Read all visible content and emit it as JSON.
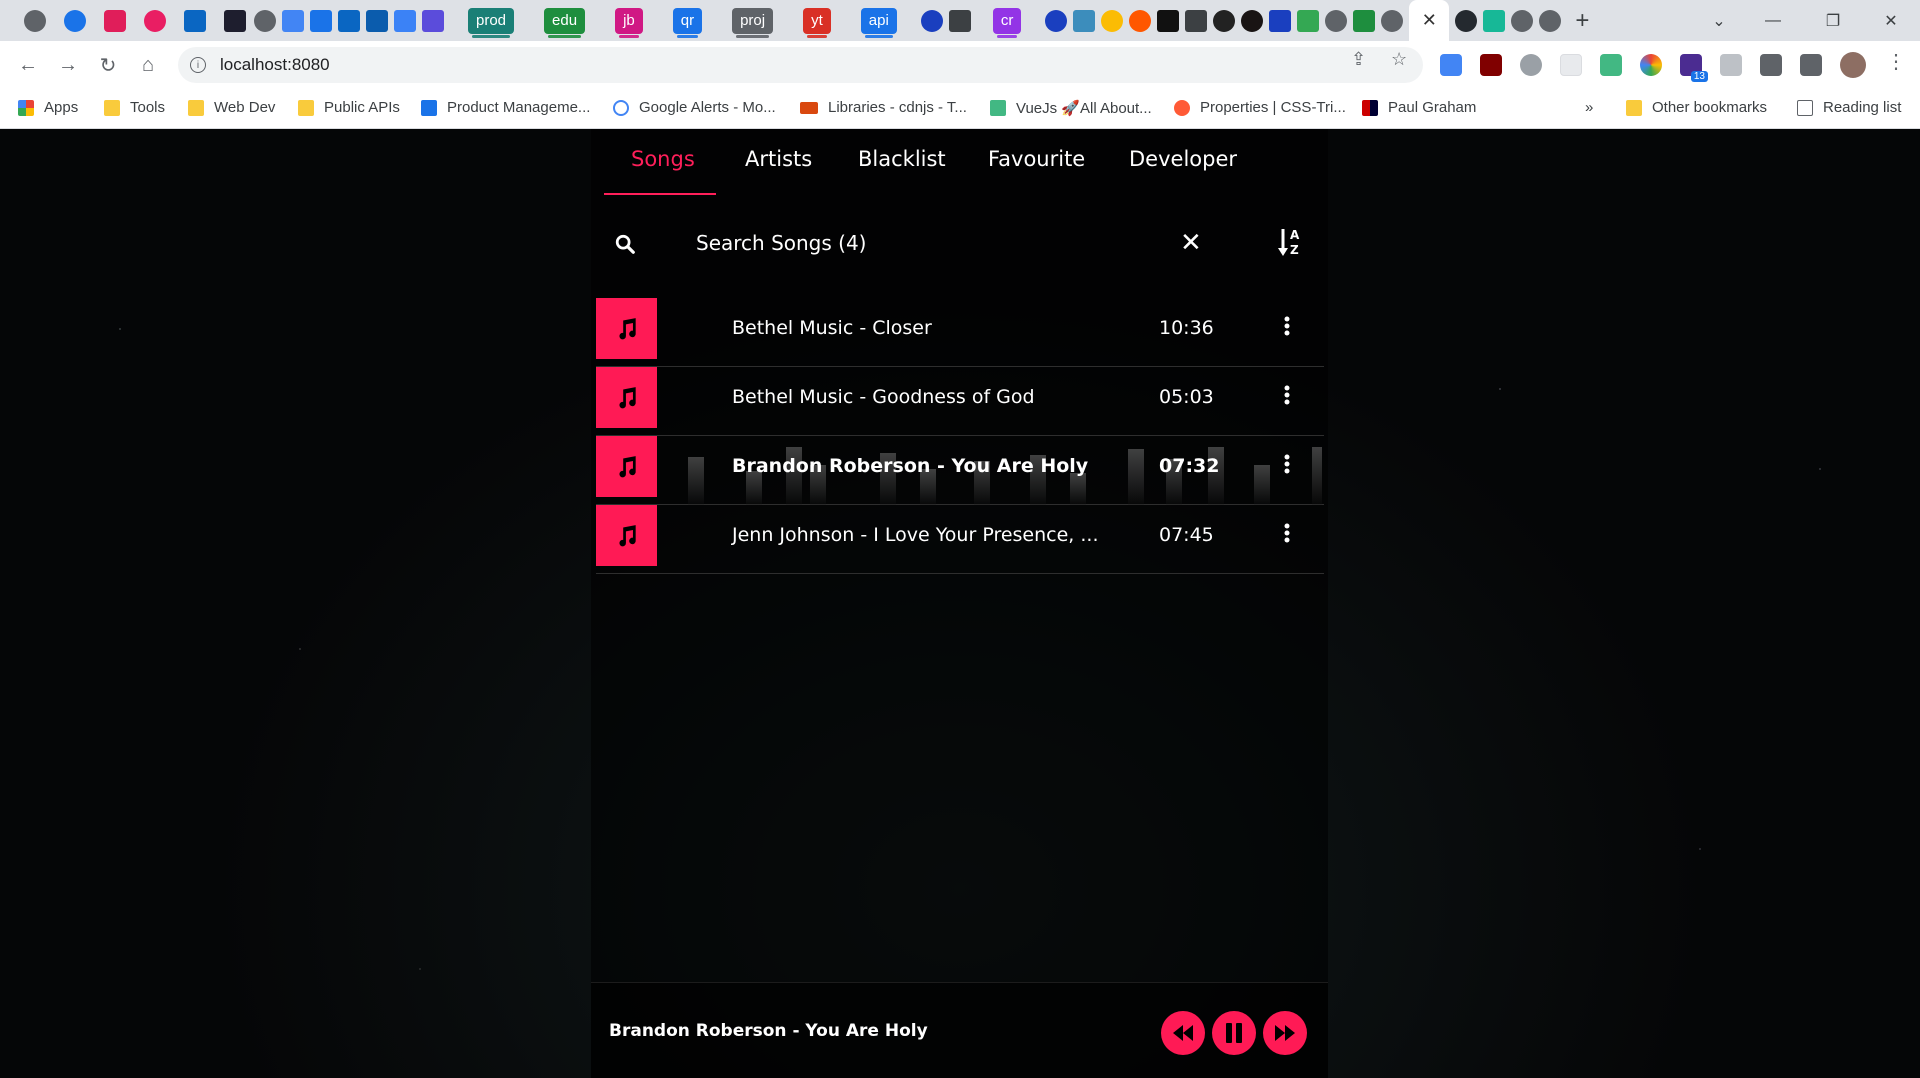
{
  "browser": {
    "url": "localhost:8080",
    "tab_groups": [
      {
        "label": "prod",
        "color": "#1a7f76"
      },
      {
        "label": "edu",
        "color": "#1e8e3e"
      },
      {
        "label": "jb",
        "color": "#d01884"
      },
      {
        "label": "qr",
        "color": "#1a73e8"
      },
      {
        "label": "proj",
        "color": "#5f6368"
      },
      {
        "label": "yt",
        "color": "#d93025"
      },
      {
        "label": "api",
        "color": "#1a73e8"
      },
      {
        "label": "cr",
        "color": "#9334e6"
      }
    ],
    "bookmarks": [
      {
        "label": "Apps"
      },
      {
        "label": "Tools"
      },
      {
        "label": "Web Dev"
      },
      {
        "label": "Public APIs"
      },
      {
        "label": "Product Manageme..."
      },
      {
        "label": "Google Alerts - Mo..."
      },
      {
        "label": "Libraries - cdnjs - T..."
      },
      {
        "label": "VueJs 🚀All About..."
      },
      {
        "label": "Properties | CSS-Tri..."
      },
      {
        "label": "Paul Graham"
      },
      {
        "label": "Other bookmarks"
      },
      {
        "label": "Reading list"
      }
    ],
    "extension_badge": "13"
  },
  "app": {
    "tabs": [
      {
        "label": "Songs",
        "active": true
      },
      {
        "label": "Artists",
        "active": false
      },
      {
        "label": "Blacklist",
        "active": false
      },
      {
        "label": "Favourite",
        "active": false
      },
      {
        "label": "Developer",
        "active": false
      }
    ],
    "search": {
      "placeholder": "Search Songs (4)",
      "value": ""
    },
    "songs": [
      {
        "title": "Bethel Music - Closer",
        "duration": "10:36",
        "playing": false
      },
      {
        "title": "Bethel Music - Goodness of God",
        "duration": "05:03",
        "playing": false
      },
      {
        "title": "Brandon Roberson - You Are Holy",
        "duration": "07:32",
        "playing": true
      },
      {
        "title": "Jenn Johnson - I Love Your Presence, ...",
        "duration": "07:45",
        "playing": false
      }
    ],
    "player": {
      "now_playing": "Brandon Roberson - You Are Holy"
    },
    "colors": {
      "accent": "#ff1a55",
      "background": "#000000",
      "text": "#ffffff"
    }
  }
}
